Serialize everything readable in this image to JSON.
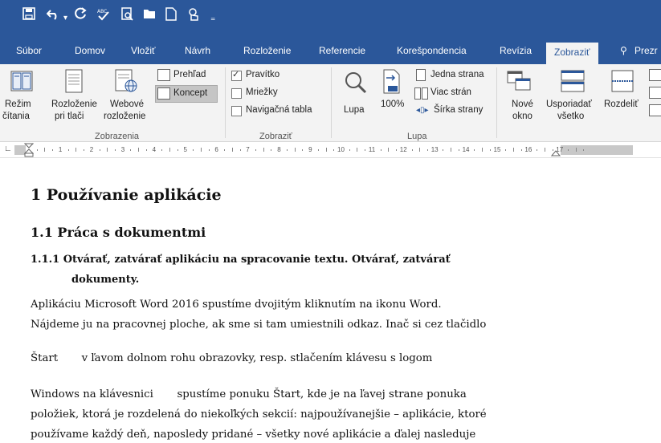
{
  "quick_access": {
    "icons": [
      "save-icon",
      "undo-icon",
      "redo-icon",
      "spelling-icon",
      "print-preview-icon",
      "open-icon",
      "new-document-icon",
      "touch-mode-icon",
      "customize-qat-icon"
    ]
  },
  "tabs": [
    {
      "label": "Súbor"
    },
    {
      "label": "Domov"
    },
    {
      "label": "Vložiť"
    },
    {
      "label": "Návrh"
    },
    {
      "label": "Rozloženie"
    },
    {
      "label": "Referencie"
    },
    {
      "label": "Korešpondencia"
    },
    {
      "label": "Revízia"
    },
    {
      "label": "Zobraziť",
      "active": true
    },
    {
      "label": "Prezr"
    }
  ],
  "ribbon": {
    "views": {
      "read_mode": [
        "Režim",
        "čítania"
      ],
      "print_layout": [
        "Rozloženie",
        "pri tlači"
      ],
      "web_layout": [
        "Webové",
        "rozloženie"
      ],
      "outline": "Prehľad",
      "draft": "Koncept",
      "group": "Zobrazenia"
    },
    "show": {
      "ruler": "Pravítko",
      "gridlines": "Mriežky",
      "nav_pane": "Navigačná tabla",
      "group": "Zobraziť"
    },
    "zoom": {
      "zoom": "Lupa",
      "percent": "100%",
      "one_page": "Jedna strana",
      "multiple_pages": "Viac strán",
      "page_width": "Šírka strany",
      "group": "Lupa"
    },
    "window": {
      "new_window": [
        "Nové",
        "okno"
      ],
      "arrange_all": [
        "Usporiadať",
        "všetko"
      ],
      "split": "Rozdeliť"
    }
  },
  "ruler": {
    "numbers": [
      "1",
      "2",
      "3",
      "4",
      "5",
      "6",
      "7",
      "8",
      "9",
      "10",
      "11",
      "12",
      "13",
      "14",
      "15",
      "16",
      "17"
    ]
  },
  "document": {
    "h1": "1  Používanie aplikácie",
    "h2": "1.1  Práca s dokumentmi",
    "h3_line1": "1.1.1  Otvárať, zatvárať aplikáciu na spracovanie textu. Otvárať, zatvárať",
    "h3_line2": "dokumenty.",
    "lines": [
      "Aplikáciu Microsoft Word 2016 spustíme dvojitým kliknutím na ikonu Word.",
      "Nájdeme ju na pracovnej ploche, ak sme si tam umiestnili odkaz. Inač si cez tlačidlo",
      "Štart       v ľavom dolnom rohu obrazovky, resp. stlačením klávesu s logom",
      "Windows na klávesnici       spustíme ponuku Štart, kde je na ľavej strane ponuka",
      "položiek, ktorá je rozdelená do niekoľkých sekcií: najpoužívanejšie – aplikácie, ktoré",
      "používame každý deň, naposledy pridané – všetky nové aplikácie a ďalej nasleduje"
    ]
  }
}
